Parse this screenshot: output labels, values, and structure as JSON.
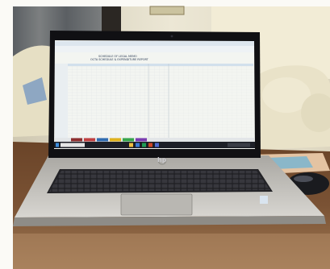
{
  "photo": {
    "subject": "open laptop on table showing spreadsheet",
    "laptop_brand_logo": "hp",
    "colors": {
      "wall": "#e7e2cf",
      "sofa": "#e8e0c6",
      "table": "#5a3a22",
      "laptop_body": "#c8c6c2",
      "bezel": "#101013",
      "keyboard": "#26262a",
      "screen_bg": "#f3f5f1",
      "sheet_header": "#d8e6f2",
      "taskbar": "#1d1f27"
    }
  },
  "spreadsheet": {
    "title_lines": [
      "SCHEDULE OF LEGAL MEMO",
      "OCTA SCHEDULE & EXPENDITURE REPORT"
    ],
    "taskbar_buttons": [
      {
        "color": "#b42424"
      },
      {
        "color": "#c83a3a"
      },
      {
        "color": "#2f6bb0"
      },
      {
        "color": "#e0b21b"
      },
      {
        "color": "#36a54a"
      },
      {
        "color": "#7a3cb0"
      }
    ]
  }
}
